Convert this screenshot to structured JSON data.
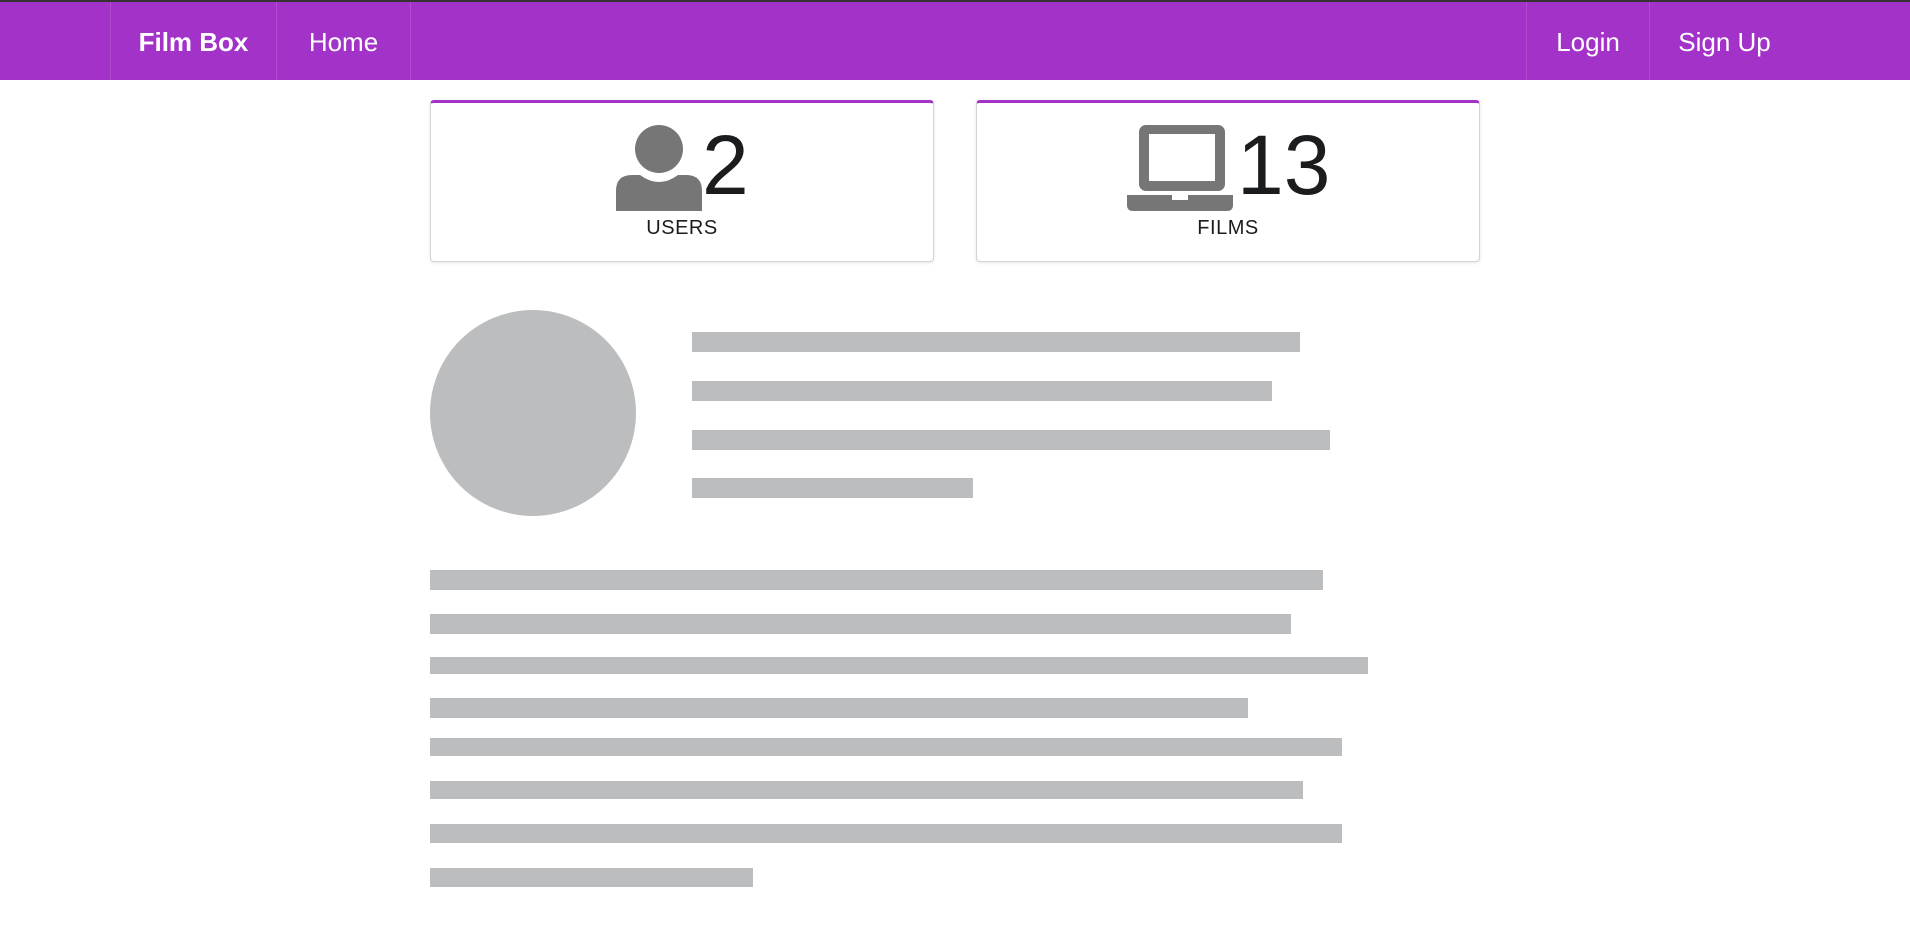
{
  "navbar": {
    "brand": "Film Box",
    "home": "Home",
    "login": "Login",
    "signup": "Sign Up",
    "background": "#a333c8"
  },
  "stats": {
    "users": {
      "value": "2",
      "label": "USERS",
      "icon": "user-icon"
    },
    "films": {
      "value": "13",
      "label": "FILMS",
      "icon": "laptop-icon"
    }
  },
  "placeholder": {
    "image": "placeholder-avatar",
    "color": "#bcbdbe"
  }
}
